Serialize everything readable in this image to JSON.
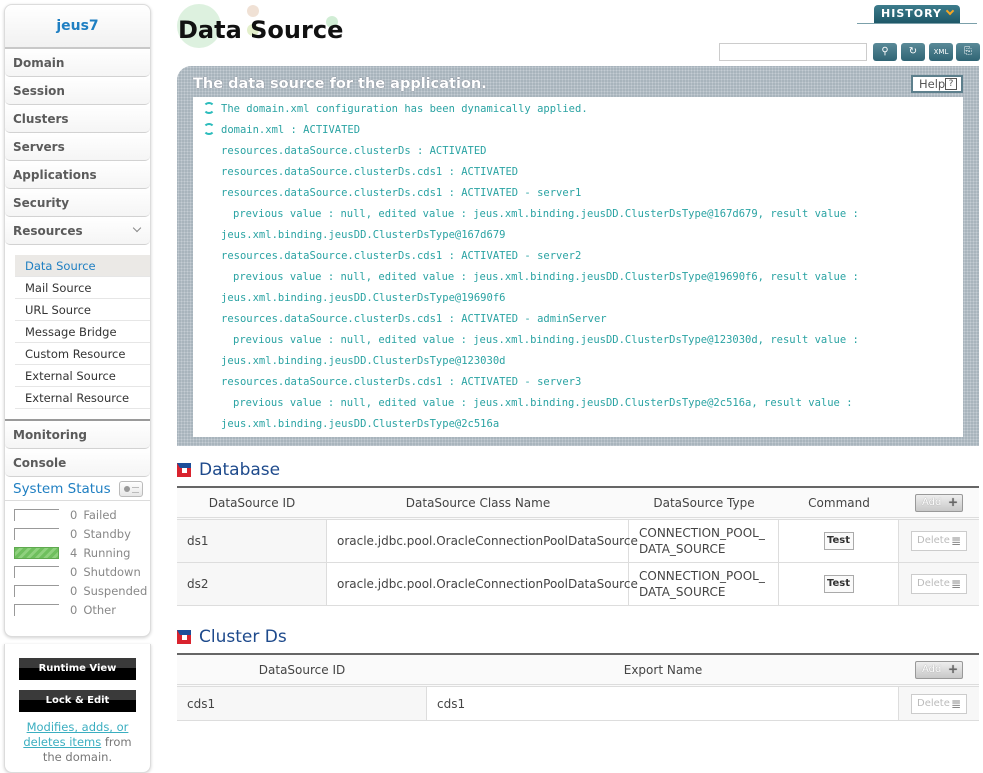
{
  "sidebar": {
    "domain_name": "jeus7",
    "nav": [
      "Domain",
      "Session",
      "Clusters",
      "Servers",
      "Applications",
      "Security",
      "Resources"
    ],
    "resources_sub": [
      "Data Source",
      "Mail Source",
      "URL Source",
      "Message Bridge",
      "Custom Resource",
      "External Source",
      "External Resource"
    ],
    "active_sub": "Data Source",
    "nav_bottom": [
      "Monitoring",
      "Console"
    ],
    "system_status": {
      "title": "System Status",
      "rows": [
        {
          "count": "0",
          "label": "Failed"
        },
        {
          "count": "0",
          "label": "Standby"
        },
        {
          "count": "4",
          "label": "Running"
        },
        {
          "count": "0",
          "label": "Shutdown"
        },
        {
          "count": "0",
          "label": "Suspended"
        },
        {
          "count": "0",
          "label": "Other"
        }
      ]
    },
    "runtime_view": "Runtime View",
    "lock_edit": "Lock & Edit",
    "help_link": "Modifies, adds, or deletes items",
    "help_suffix": " from the domain."
  },
  "header": {
    "title": "Data Source",
    "history": "HISTORY",
    "search_placeholder": "",
    "tools": [
      "search-icon",
      "refresh-icon",
      "xml-export-icon",
      "resource-export-icon"
    ]
  },
  "info": {
    "title": "The data source for the application.",
    "help": "Help",
    "log": [
      {
        "lvl": 0,
        "icon": true,
        "text": "The domain.xml configuration has been dynamically applied."
      },
      {
        "lvl": 0,
        "icon": true,
        "text": "domain.xml : ACTIVATED"
      },
      {
        "lvl": 1,
        "text": "resources.dataSource.clusterDs : ACTIVATED"
      },
      {
        "lvl": 1,
        "text": "resources.dataSource.clusterDs.cds1 : ACTIVATED"
      },
      {
        "lvl": 1,
        "text": "resources.dataSource.clusterDs.cds1 : ACTIVATED - server1"
      },
      {
        "lvl": 2,
        "text": "previous value : null, edited value : jeus.xml.binding.jeusDD.ClusterDsType@167d679, result value :"
      },
      {
        "lvl": 1,
        "text": "jeus.xml.binding.jeusDD.ClusterDsType@167d679"
      },
      {
        "lvl": 1,
        "text": "resources.dataSource.clusterDs.cds1 : ACTIVATED - server2"
      },
      {
        "lvl": 2,
        "text": "previous value : null, edited value : jeus.xml.binding.jeusDD.ClusterDsType@19690f6, result value :"
      },
      {
        "lvl": 1,
        "text": "jeus.xml.binding.jeusDD.ClusterDsType@19690f6"
      },
      {
        "lvl": 1,
        "text": "resources.dataSource.clusterDs.cds1 : ACTIVATED - adminServer"
      },
      {
        "lvl": 2,
        "text": "previous value : null, edited value : jeus.xml.binding.jeusDD.ClusterDsType@123030d, result value :"
      },
      {
        "lvl": 1,
        "text": "jeus.xml.binding.jeusDD.ClusterDsType@123030d"
      },
      {
        "lvl": 1,
        "text": "resources.dataSource.clusterDs.cds1 : ACTIVATED - server3"
      },
      {
        "lvl": 2,
        "text": "previous value : null, edited value : jeus.xml.binding.jeusDD.ClusterDsType@2c516a, result value :"
      },
      {
        "lvl": 1,
        "text": "jeus.xml.binding.jeusDD.ClusterDsType@2c516a"
      }
    ]
  },
  "database": {
    "title": "Database",
    "columns": [
      "DataSource ID",
      "DataSource Class Name",
      "DataSource Type",
      "Command"
    ],
    "add": "Add",
    "test": "Test",
    "delete": "Delete",
    "rows": [
      {
        "id": "ds1",
        "class": "oracle.jdbc.pool.OracleConnectionPoolDataSource",
        "type": "CONNECTION_POOL_ DATA_SOURCE"
      },
      {
        "id": "ds2",
        "class": "oracle.jdbc.pool.OracleConnectionPoolDataSource",
        "type": "CONNECTION_POOL_ DATA_SOURCE"
      }
    ]
  },
  "cluster": {
    "title": "Cluster Ds",
    "columns": [
      "DataSource ID",
      "Export Name"
    ],
    "add": "Add",
    "delete": "Delete",
    "rows": [
      {
        "id": "cds1",
        "export": "cds1"
      }
    ]
  }
}
